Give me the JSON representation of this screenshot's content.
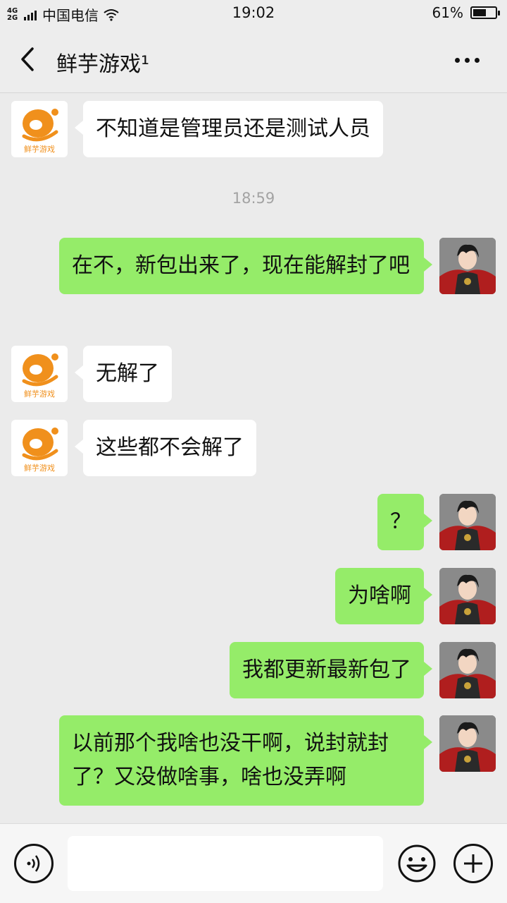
{
  "status_bar": {
    "network_type": "4G 2G",
    "carrier": "中国电信",
    "time": "19:02",
    "battery_percent_label": "61%",
    "battery_level": 0.61
  },
  "nav": {
    "title": "鲜芋游戏¹",
    "back_icon": "chevron-left-icon",
    "more_icon": "more-dots-icon"
  },
  "contact_logo_text": "鲜芋游戏",
  "chat": {
    "timestamp": "18:59",
    "messages": [
      {
        "from": "them",
        "text": "不知道是管理员还是测试人员"
      },
      {
        "from": "me",
        "text": "在不，新包出来了，现在能解封了吧"
      },
      {
        "from": "them",
        "text": "无解了"
      },
      {
        "from": "them",
        "text": "这些都不会解了"
      },
      {
        "from": "me",
        "text": "？"
      },
      {
        "from": "me",
        "text": "为啥啊"
      },
      {
        "from": "me",
        "text": "我都更新最新包了"
      },
      {
        "from": "me",
        "text": "以前那个我啥也没干啊，说封就封了？又没做啥事，啥也没弄啊"
      }
    ]
  },
  "input_bar": {
    "voice_icon": "voice-icon",
    "emoji_icon": "emoji-icon",
    "plus_icon": "plus-icon",
    "placeholder": ""
  },
  "colors": {
    "my_bubble": "#95ec69",
    "their_bubble": "#ffffff",
    "background": "#ebebeb",
    "logo_orange": "#f0901c"
  }
}
